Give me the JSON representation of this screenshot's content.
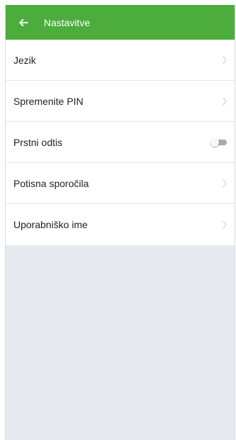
{
  "app_bar": {
    "title": "Nastavitve",
    "back_icon": "arrow-left-icon",
    "background_color": "#4cac3c"
  },
  "settings": {
    "items": [
      {
        "label": "Jezik",
        "control": "chevron-right-icon"
      },
      {
        "label": "Spremenite PIN",
        "control": "chevron-right-icon"
      },
      {
        "label": "Prstni odtis",
        "control": "toggle",
        "enabled": false
      },
      {
        "label": "Potisna sporočila",
        "control": "chevron-right-icon"
      },
      {
        "label": "Uporabniško ime",
        "control": "chevron-right-icon"
      }
    ]
  },
  "colors": {
    "background": "#e6e9f0",
    "surface": "#ffffff",
    "divider": "#e7e7e7"
  }
}
